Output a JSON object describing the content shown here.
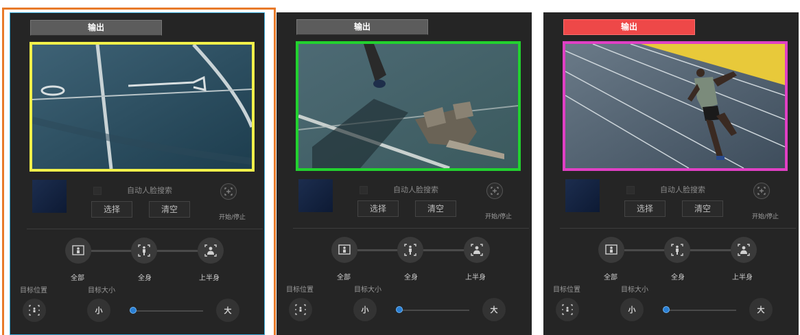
{
  "colors": {
    "panel_bg": "#252525",
    "selection_frame": "#e87a2a",
    "active_panel_border": "#35a9d8",
    "preview_borders": [
      "#f1f04a",
      "#22d12f",
      "#e040c4"
    ],
    "live_button": "#ee4848",
    "slider_knob": "#2a7fd4"
  },
  "panels": [
    {
      "output_label": "输出",
      "preview_icon": "track-image",
      "face_search_label": "自动人脸搜索",
      "select_label": "选择",
      "clear_label": "清空",
      "start_stop_label": "开始/停止",
      "modes": [
        {
          "label": "全部",
          "icon": "full-frame-person-icon"
        },
        {
          "label": "全身",
          "icon": "full-body-person-icon"
        },
        {
          "label": "上半身",
          "icon": "upper-body-person-icon"
        }
      ],
      "target_position_label": "目标位置",
      "target_size_label": "目标大小",
      "small_label": "小",
      "large_label": "大",
      "size_value": 0
    },
    {
      "output_label": "输出",
      "preview_icon": "starting-blocks-image",
      "face_search_label": "自动人脸搜索",
      "select_label": "选择",
      "clear_label": "清空",
      "start_stop_label": "开始/停止",
      "modes": [
        {
          "label": "全部",
          "icon": "full-frame-person-icon"
        },
        {
          "label": "全身",
          "icon": "full-body-person-icon"
        },
        {
          "label": "上半身",
          "icon": "upper-body-person-icon"
        }
      ],
      "target_position_label": "目标位置",
      "target_size_label": "目标大小",
      "small_label": "小",
      "large_label": "大",
      "size_value": 0
    },
    {
      "output_label": "输出",
      "preview_icon": "sprinter-image",
      "face_search_label": "自动人脸搜索",
      "select_label": "选择",
      "clear_label": "清空",
      "start_stop_label": "开始/停止",
      "modes": [
        {
          "label": "全部",
          "icon": "full-frame-person-icon"
        },
        {
          "label": "全身",
          "icon": "full-body-person-icon"
        },
        {
          "label": "上半身",
          "icon": "upper-body-person-icon"
        }
      ],
      "target_position_label": "目标位置",
      "target_size_label": "目标大小",
      "small_label": "小",
      "large_label": "大",
      "size_value": 0
    }
  ]
}
